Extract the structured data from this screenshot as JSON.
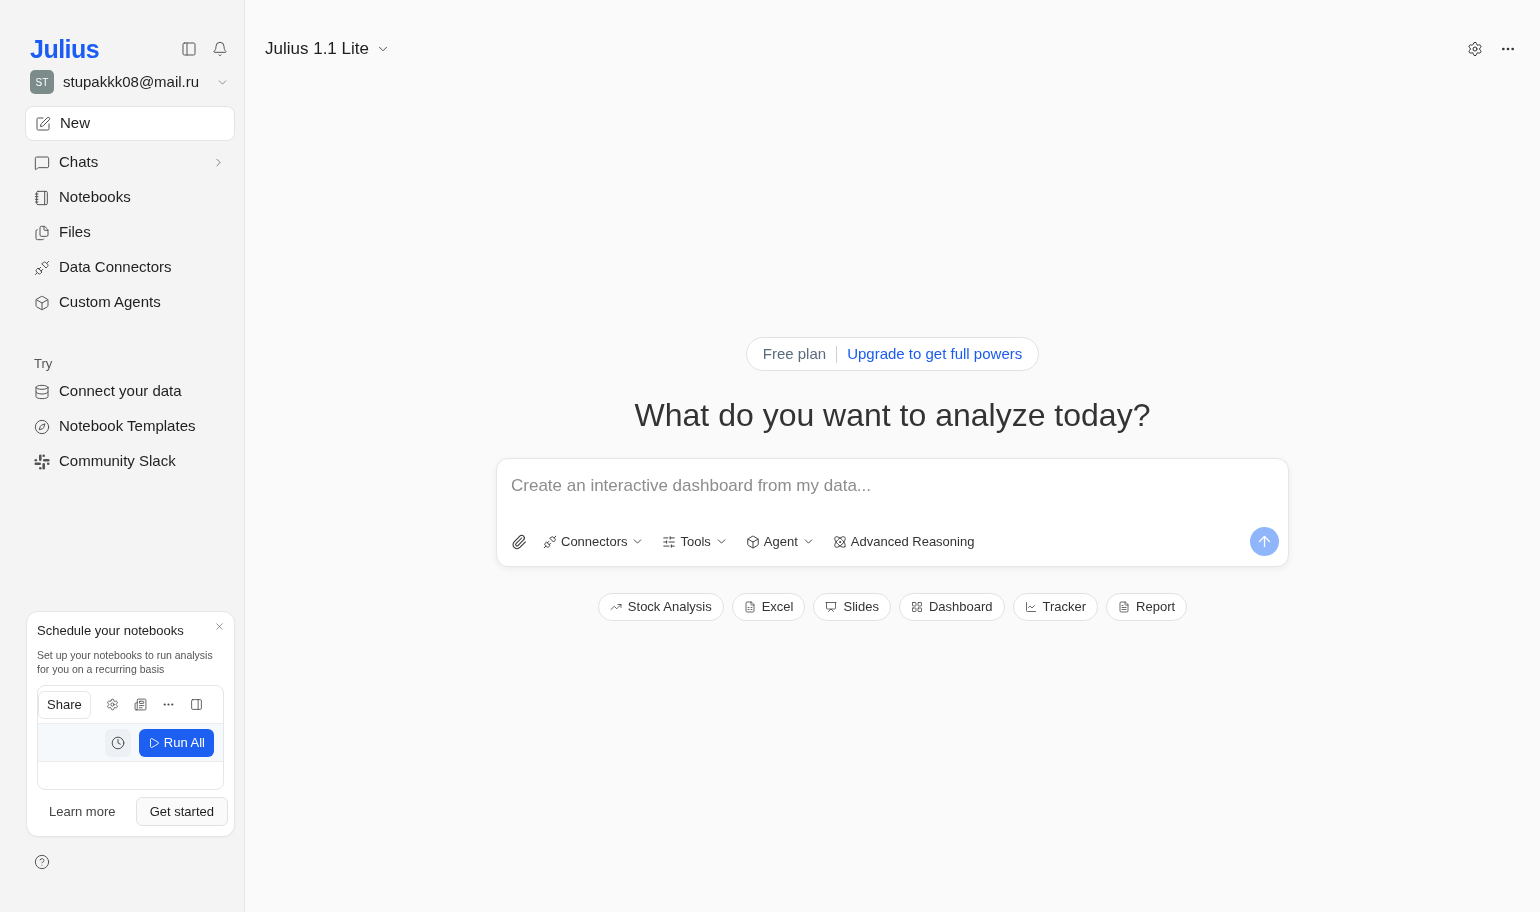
{
  "sidebar": {
    "logo": "Julius",
    "account": {
      "initials": "ST",
      "email": "stupakkk08@mail.ru"
    },
    "new_button": "New",
    "nav_items": [
      {
        "label": "Chats",
        "has_submenu": true
      },
      {
        "label": "Notebooks",
        "has_submenu": false
      },
      {
        "label": "Files",
        "has_submenu": false
      },
      {
        "label": "Data Connectors",
        "has_submenu": false
      },
      {
        "label": "Custom Agents",
        "has_submenu": false
      }
    ],
    "try_section": {
      "heading": "Try",
      "items": [
        {
          "label": "Connect your data"
        },
        {
          "label": "Notebook Templates"
        },
        {
          "label": "Community Slack"
        }
      ]
    },
    "promo_card": {
      "title": "Schedule your notebooks",
      "description": "Set up your notebooks to run analysis for you on a recurring basis",
      "preview": {
        "share_button": "Share",
        "run_button": "Run All"
      },
      "learn_more": "Learn more",
      "cta": "Get started"
    }
  },
  "header": {
    "model_name": "Julius 1.1 Lite"
  },
  "plan_banner": {
    "plan": "Free plan",
    "upgrade_link": "Upgrade to get full powers"
  },
  "headline": "What do you want to analyze today?",
  "prompt": {
    "placeholder": "Create an interactive dashboard from my data...",
    "tools": [
      {
        "label": "Connectors",
        "dropdown": true
      },
      {
        "label": "Tools",
        "dropdown": true
      },
      {
        "label": "Agent",
        "dropdown": true
      },
      {
        "label": "Advanced Reasoning",
        "dropdown": false
      }
    ],
    "send_button": {
      "disabled": true
    }
  },
  "suggestions": [
    {
      "label": "Stock Analysis"
    },
    {
      "label": "Excel"
    },
    {
      "label": "Slides"
    },
    {
      "label": "Dashboard"
    },
    {
      "label": "Tracker"
    },
    {
      "label": "Report"
    }
  ]
}
